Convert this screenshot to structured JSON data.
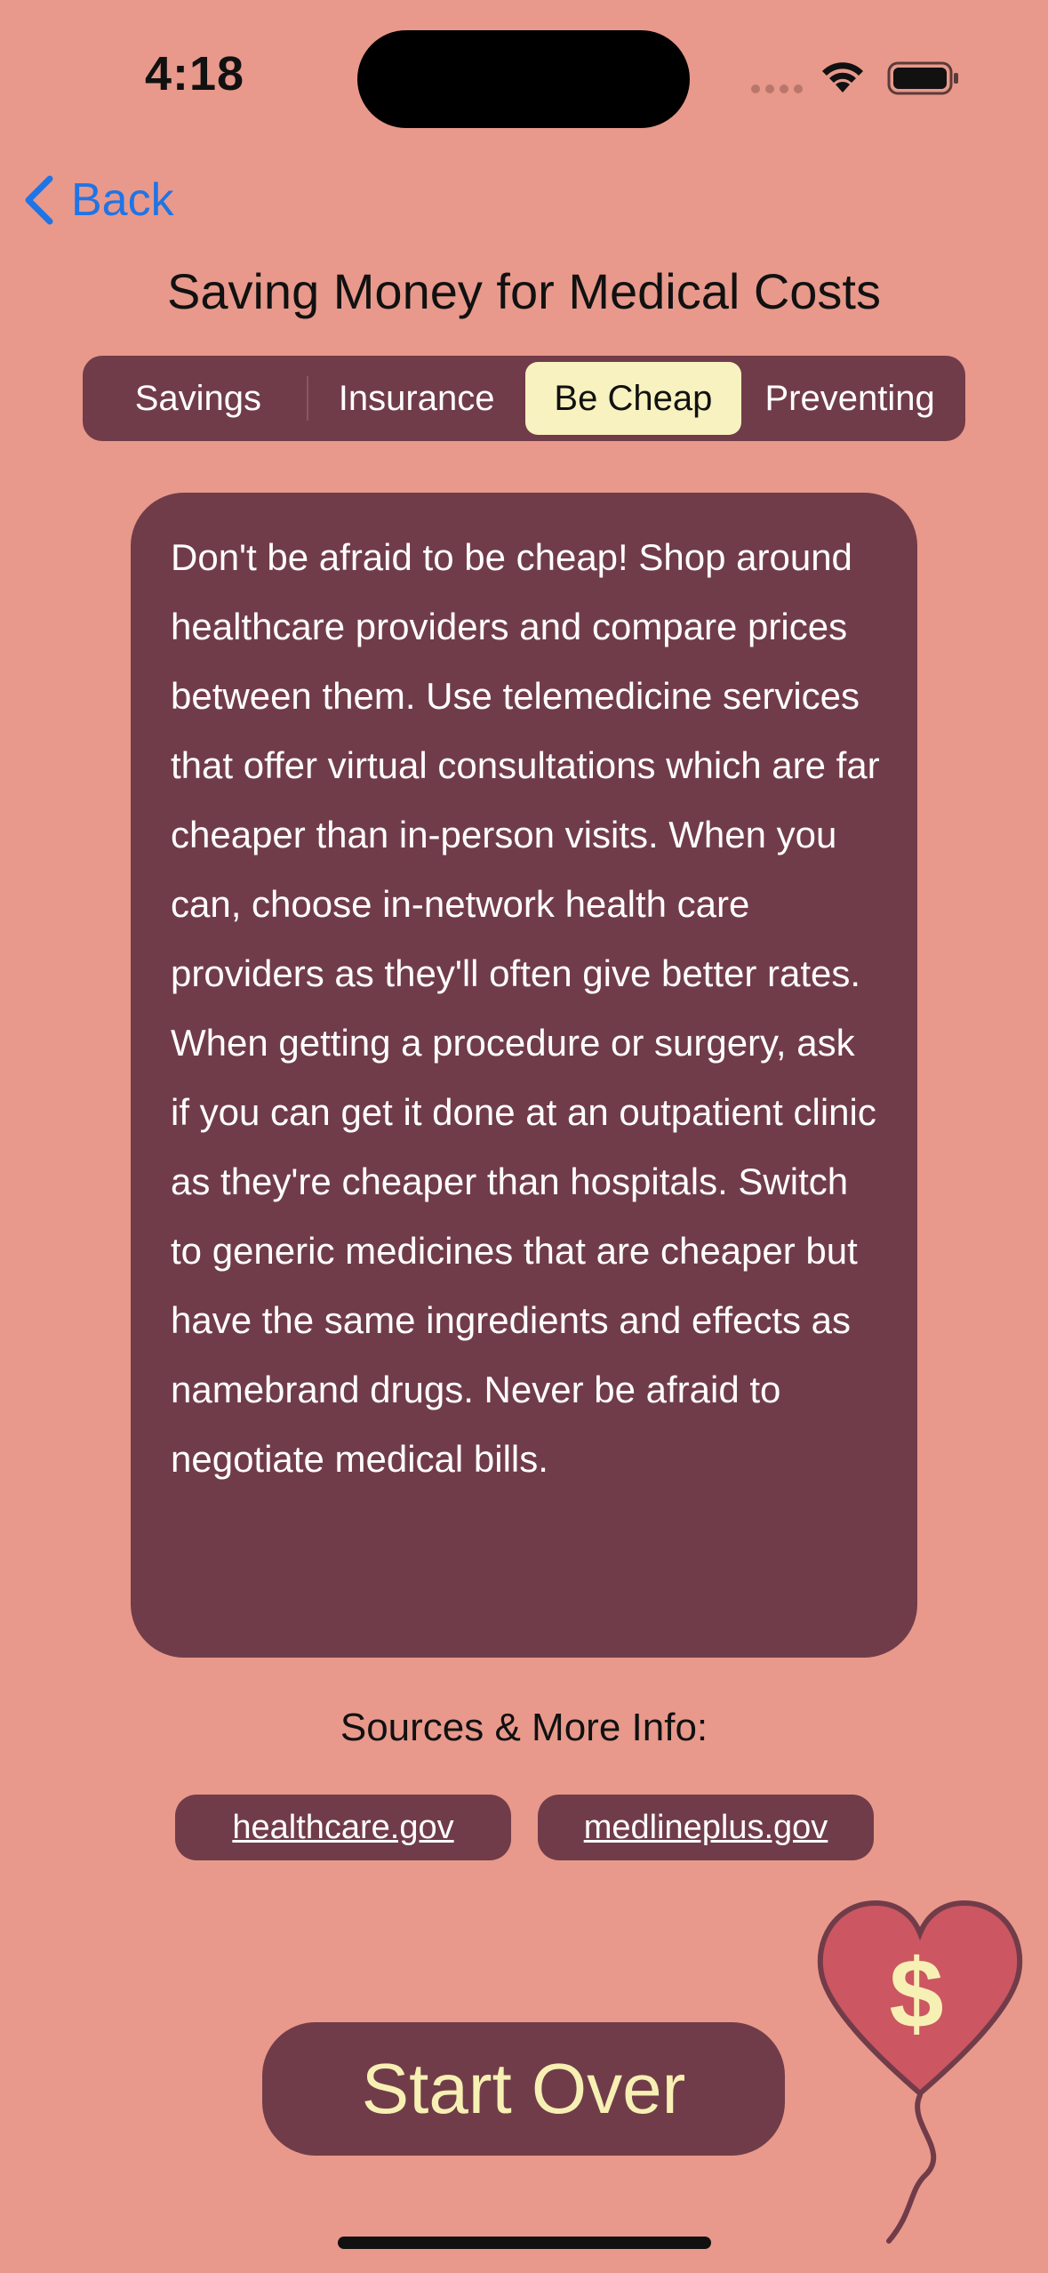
{
  "status_bar": {
    "time": "4:18"
  },
  "nav": {
    "back_label": "Back",
    "title": "Saving Money for Medical Costs"
  },
  "tabs": [
    {
      "label": "Savings",
      "selected": false
    },
    {
      "label": "Insurance",
      "selected": false
    },
    {
      "label": "Be Cheap",
      "selected": true
    },
    {
      "label": "Preventing",
      "selected": false
    }
  ],
  "content": {
    "body": "Don't be afraid to be cheap! Shop around healthcare providers and compare prices between them. Use telemedicine services that offer virtual consultations which are far cheaper than in-person visits. When you can, choose in-network health care providers as they'll often give better rates. When getting a procedure or surgery, ask if you can get it done at an outpatient clinic as they're cheaper than hospitals. Switch to generic medicines that are cheaper but have the same ingredients and effects as namebrand drugs. Never be afraid to negotiate medical bills."
  },
  "sources": {
    "title": "Sources & More Info:",
    "links": [
      "healthcare.gov",
      "medlineplus.gov"
    ]
  },
  "actions": {
    "start_over_label": "Start Over"
  },
  "decoration": {
    "balloon_symbol": "$",
    "icons": [
      "wifi-icon",
      "battery-icon",
      "chevron-left-icon",
      "heart-balloon-icon"
    ]
  },
  "colors": {
    "background": "#e8998b",
    "card": "#713c49",
    "selected_tab": "#f7f2bf",
    "accent_link": "#1f74e6",
    "button_text": "#f7f0b4",
    "heart": "#cc5661"
  }
}
